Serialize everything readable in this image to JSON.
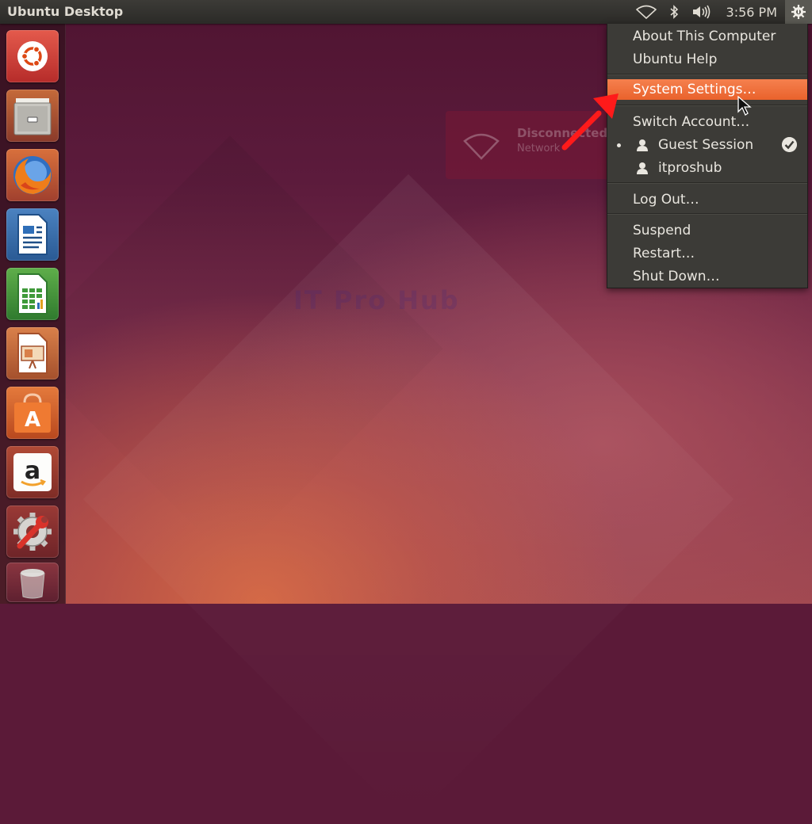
{
  "panel": {
    "title": "Ubuntu Desktop",
    "clock": "3:56 PM",
    "indicator_icons": [
      "wifi-icon",
      "bluetooth-icon",
      "volume-icon",
      "gear-icon"
    ]
  },
  "launcher": {
    "items": [
      {
        "name": "dash-home",
        "icon": "ubuntu-logo-icon"
      },
      {
        "name": "files",
        "icon": "file-cabinet-icon"
      },
      {
        "name": "firefox",
        "icon": "firefox-icon"
      },
      {
        "name": "writer",
        "icon": "libreoffice-writer-icon"
      },
      {
        "name": "calc",
        "icon": "libreoffice-calc-icon"
      },
      {
        "name": "impress",
        "icon": "libreoffice-impress-icon"
      },
      {
        "name": "software-center",
        "icon": "shopping-bag-icon"
      },
      {
        "name": "amazon",
        "icon": "amazon-icon"
      },
      {
        "name": "system-settings",
        "icon": "wrench-gear-icon"
      },
      {
        "name": "trash",
        "icon": "trash-icon"
      }
    ]
  },
  "notification": {
    "title": "Disconnected",
    "body": "Network"
  },
  "menu": {
    "about": "About This Computer",
    "help": "Ubuntu Help",
    "settings": "System Settings…",
    "switch_account": "Switch Account…",
    "guest": "Guest Session",
    "user": "itproshub",
    "logout": "Log Out…",
    "suspend": "Suspend",
    "restart": "Restart…",
    "shutdown": "Shut Down…"
  },
  "colors": {
    "highlight": "#e9622c",
    "panel": "#3c3b37",
    "arrow": "#ff0000"
  }
}
